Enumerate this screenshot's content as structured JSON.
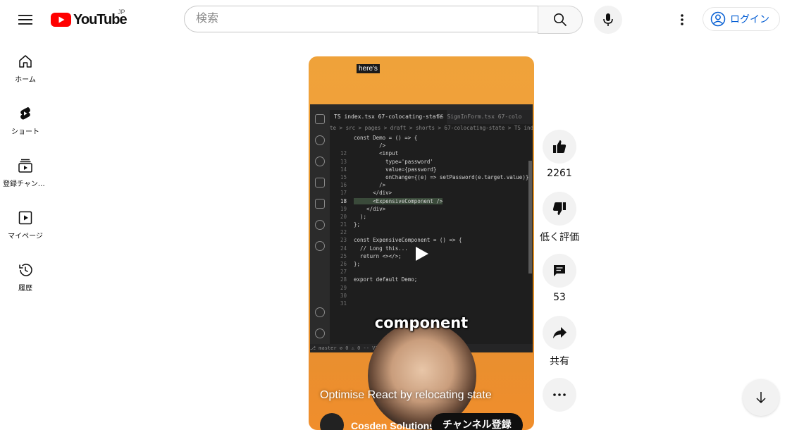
{
  "header": {
    "logo_text": "YouTube",
    "country_code": "JP",
    "search_placeholder": "検索",
    "login_label": "ログイン",
    "icons": [
      "hamburger-menu-icon",
      "search-icon",
      "microphone-icon",
      "more-vert-icon",
      "account-icon"
    ]
  },
  "sidebar": {
    "items": [
      {
        "label": "ホーム",
        "icon": "home-icon"
      },
      {
        "label": "ショート",
        "icon": "shorts-icon"
      },
      {
        "label": "登録チャンネル",
        "icon": "subscriptions-icon"
      },
      {
        "label": "マイページ",
        "icon": "my-page-icon"
      },
      {
        "label": "履歴",
        "icon": "history-icon"
      }
    ]
  },
  "player": {
    "caption_top": "here's",
    "caption_mid": "component",
    "title": "Optimise React by relocating state",
    "channel_name": "Cosden Solutions",
    "subscribe_label": "チャンネル登録",
    "editor": {
      "tab_active": "TS index.tsx 67-colocating-state",
      "tab_inactive": "TS SignInForm.tsx 67-colo",
      "breadcrumb": "te > src > pages > draft > shorts > 67-colocating-state > TS index.tsx > [e] Expe",
      "status": "⎇ master   ⊘ 0 ⚠ 0        -- VISUAL --",
      "lines": [
        {
          "n": "",
          "t": "const Demo = () => {"
        },
        {
          "n": "",
          "t": "        />"
        },
        {
          "n": "12",
          "t": "        <input"
        },
        {
          "n": "13",
          "t": "          type='password'"
        },
        {
          "n": "14",
          "t": "          value={password}"
        },
        {
          "n": "15",
          "t": "          onChange={(e) => setPassword(e.target.value)}"
        },
        {
          "n": "16",
          "t": "        />"
        },
        {
          "n": "17",
          "t": "      </div>"
        },
        {
          "n": "18",
          "t": "      <ExpensiveComponent />"
        },
        {
          "n": "19",
          "t": "    </div>"
        },
        {
          "n": "20",
          "t": "  );"
        },
        {
          "n": "21",
          "t": "};"
        },
        {
          "n": "22",
          "t": ""
        },
        {
          "n": "23",
          "t": "const ExpensiveComponent = () => {"
        },
        {
          "n": "24",
          "t": "  // Long this..."
        },
        {
          "n": "25",
          "t": "  return <></>;"
        },
        {
          "n": "26",
          "t": "};"
        },
        {
          "n": "27",
          "t": ""
        },
        {
          "n": "28",
          "t": "export default Demo;"
        },
        {
          "n": "29",
          "t": ""
        },
        {
          "n": "30",
          "t": ""
        },
        {
          "n": "31",
          "t": ""
        }
      ]
    }
  },
  "actions": {
    "like_count": "2261",
    "dislike_label": "低く評価",
    "comment_count": "53",
    "share_label": "共有"
  },
  "colors": {
    "brand_red": "#ff0000",
    "link_blue": "#065fd4",
    "chip_gray": "#f2f2f2"
  }
}
